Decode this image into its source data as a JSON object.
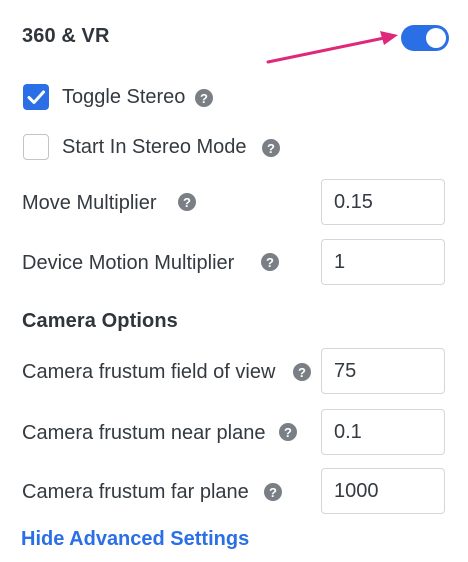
{
  "section": {
    "title": "360 & VR",
    "toggle_on": true
  },
  "stereo": {
    "toggle_stereo": {
      "label": "Toggle Stereo",
      "checked": true
    },
    "start_in_stereo": {
      "label": "Start In Stereo Mode",
      "checked": false
    }
  },
  "fields": {
    "move_multiplier": {
      "label": "Move Multiplier",
      "value": "0.15"
    },
    "device_motion_multiplier": {
      "label": "Device Motion Multiplier",
      "value": "1"
    }
  },
  "camera": {
    "title": "Camera Options",
    "fov": {
      "label": "Camera frustum field of view",
      "value": "75"
    },
    "near": {
      "label": "Camera frustum near plane",
      "value": "0.1"
    },
    "far": {
      "label": "Camera frustum far plane",
      "value": "1000"
    }
  },
  "links": {
    "hide_advanced": "Hide Advanced Settings"
  },
  "icons": {
    "help": "?"
  },
  "colors": {
    "accent": "#2b6fe6",
    "arrow": "#e0287a"
  }
}
